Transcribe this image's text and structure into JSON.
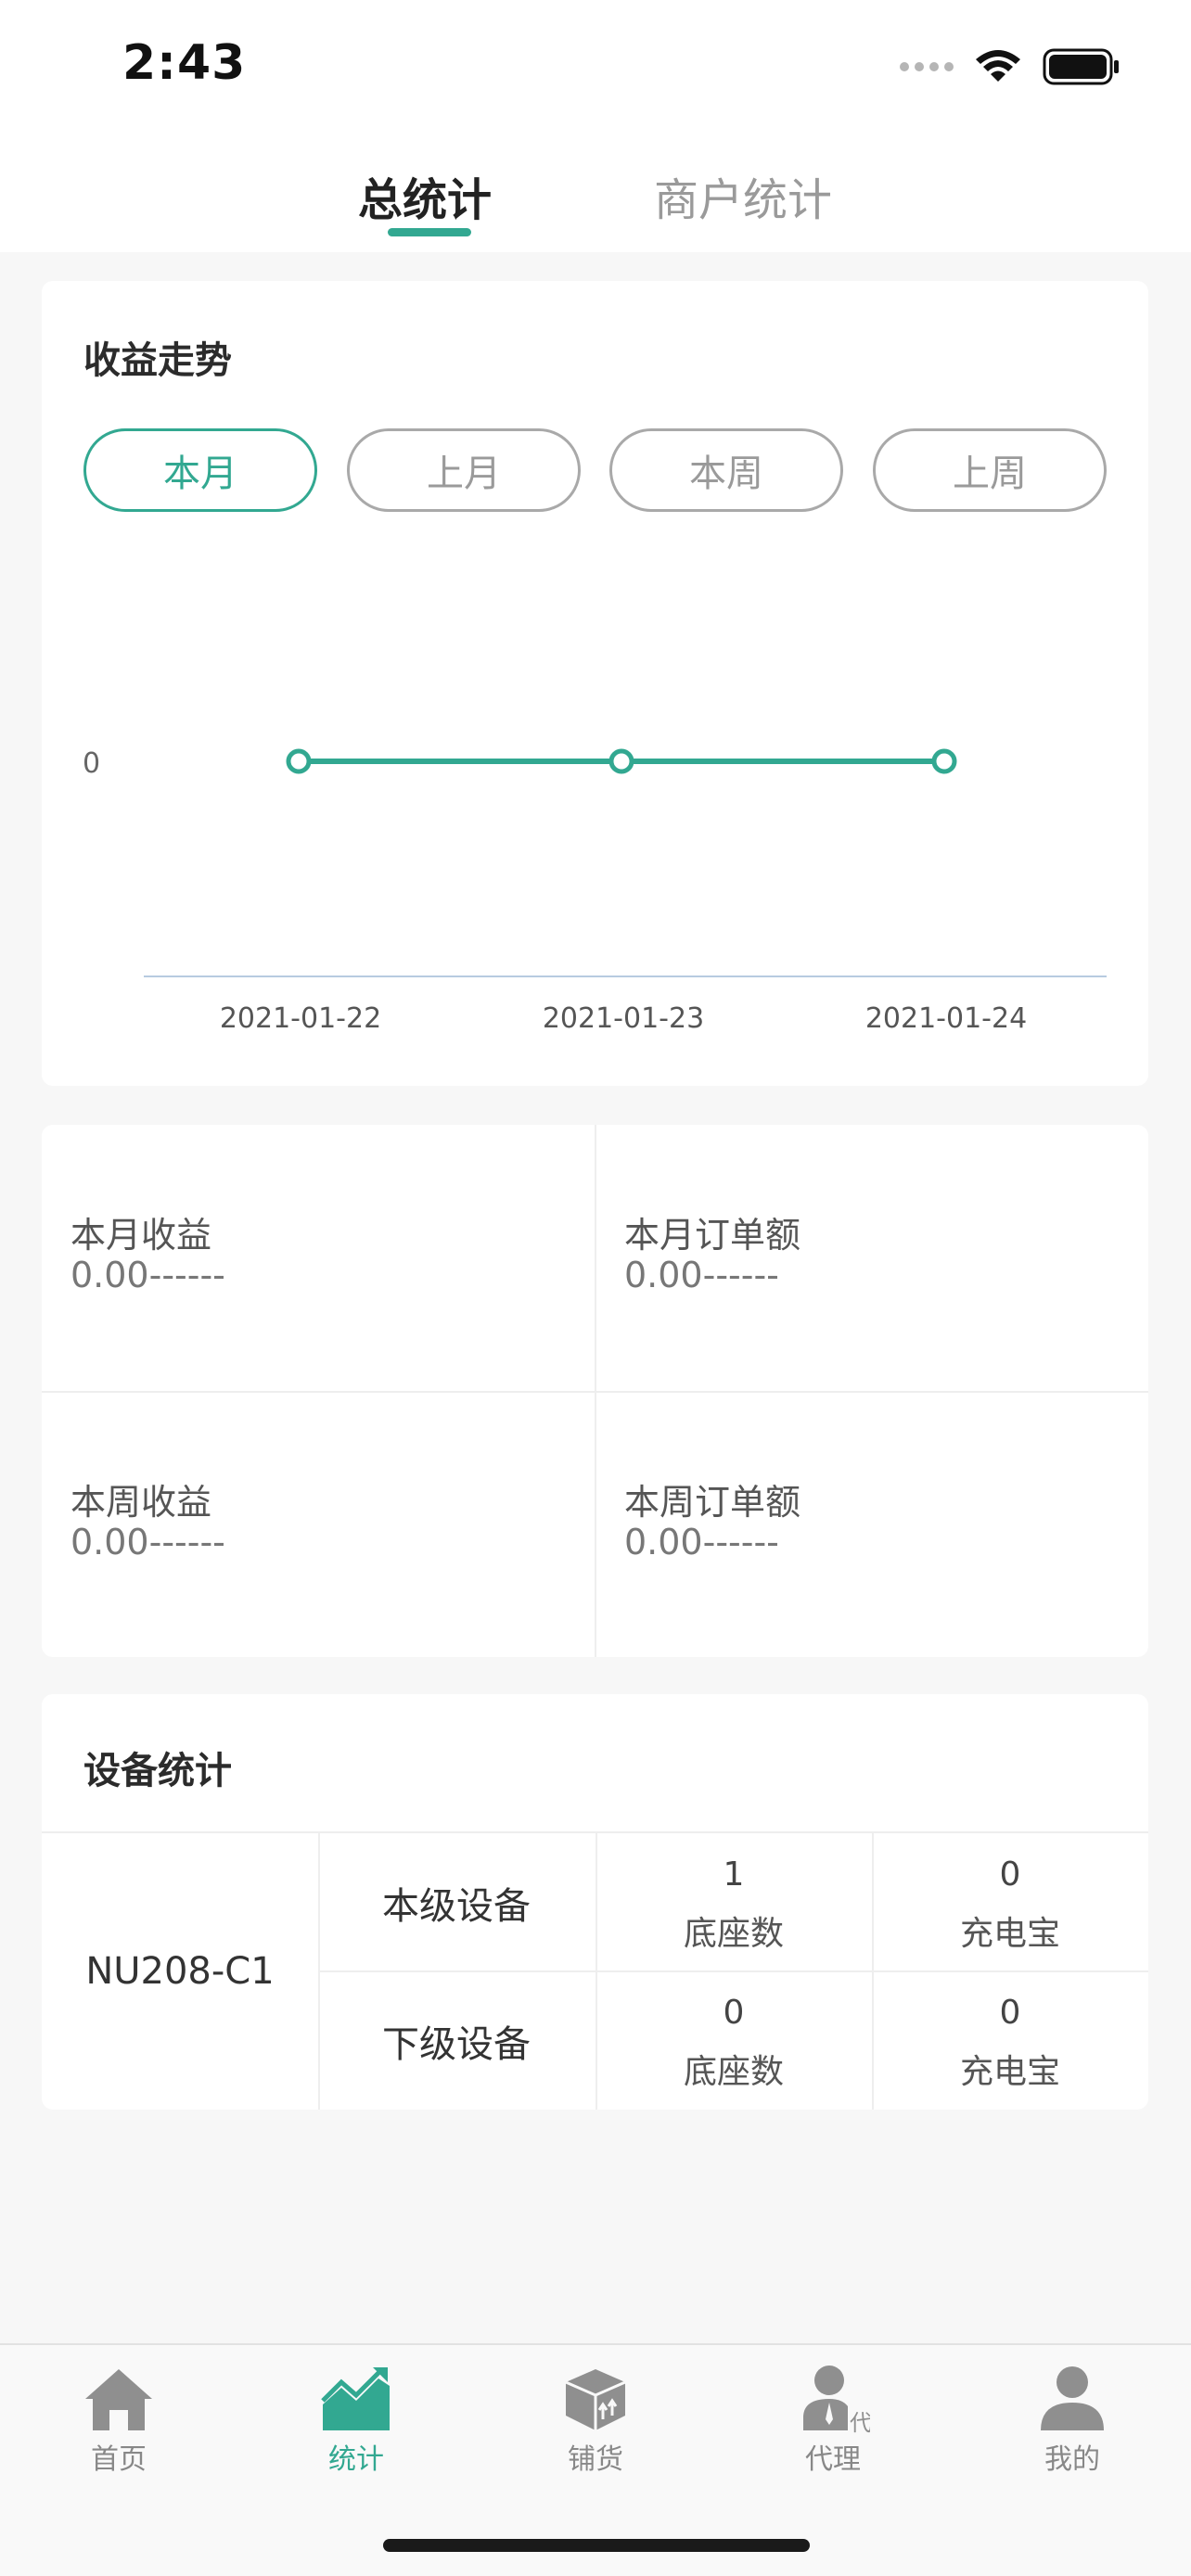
{
  "status_bar": {
    "time": "2:43"
  },
  "tabs": [
    {
      "label": "总统计",
      "active": true
    },
    {
      "label": "商户统计",
      "active": false
    }
  ],
  "trend": {
    "title": "收益走势",
    "periods": [
      {
        "label": "本月",
        "active": true
      },
      {
        "label": "上月",
        "active": false
      },
      {
        "label": "本周",
        "active": false
      },
      {
        "label": "上周",
        "active": false
      }
    ]
  },
  "chart_data": {
    "type": "line",
    "x": [
      "2021-01-22",
      "2021-01-23",
      "2021-01-24"
    ],
    "series": [
      {
        "values": [
          0,
          0,
          0
        ]
      }
    ],
    "y_ticks": [
      "0"
    ],
    "grid": false,
    "color": "#32a891"
  },
  "summary": [
    {
      "label": "本月收益",
      "value": "0.00------"
    },
    {
      "label": "本月订单额",
      "value": "0.00------"
    },
    {
      "label": "本周收益",
      "value": "0.00------"
    },
    {
      "label": "本周订单额",
      "value": "0.00------"
    }
  ],
  "devices": {
    "title": "设备统计",
    "model": "NU208-C1",
    "rows": [
      {
        "level": "本级设备",
        "base_count": "1",
        "base_label": "底座数",
        "power_bank_count": "0",
        "power_bank_label": "充电宝"
      },
      {
        "level": "下级设备",
        "base_count": "0",
        "base_label": "底座数",
        "power_bank_count": "0",
        "power_bank_label": "充电宝"
      }
    ]
  },
  "nav": [
    {
      "label": "首页",
      "icon": "home-icon",
      "active": false
    },
    {
      "label": "统计",
      "icon": "chart-trend-icon",
      "active": true
    },
    {
      "label": "铺货",
      "icon": "box-icon",
      "active": false
    },
    {
      "label": "代理",
      "icon": "agent-icon",
      "active": false
    },
    {
      "label": "我的",
      "icon": "user-icon",
      "active": false
    }
  ],
  "colors": {
    "accent": "#32a891",
    "inactive": "#9a9a9a",
    "background": "#f7f7f7"
  }
}
